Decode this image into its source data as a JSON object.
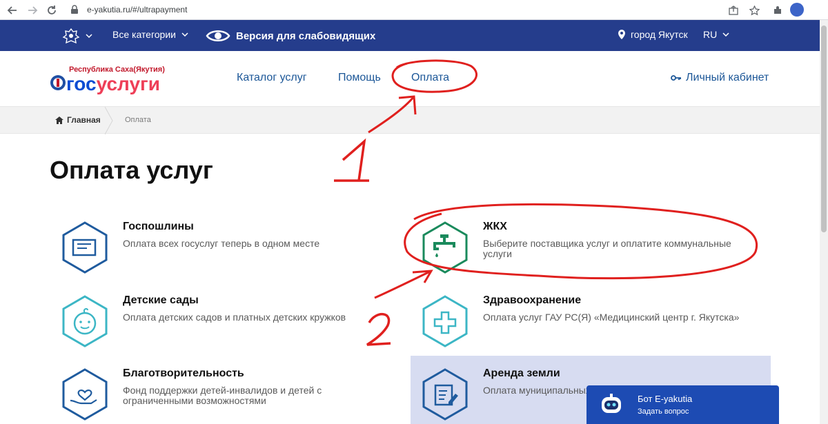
{
  "browser": {
    "url": "e-yakutia.ru/#/ultrapayment",
    "back_icon": "arrow-left-icon",
    "forward_icon": "arrow-right-icon",
    "reload_icon": "reload-icon"
  },
  "topbar": {
    "categories": "Все категории",
    "low_vision": "Версия для слабовидящих",
    "city": "город Якутск",
    "language": "RU"
  },
  "header": {
    "logo_republic": "Республика Саха(Якутия)",
    "logo_gos": "гос",
    "logo_uslugi": "услуги",
    "nav": [
      "Каталог услуг",
      "Помощь",
      "Оплата"
    ],
    "cabinet": "Личный кабинет"
  },
  "breadcrumb": {
    "home": "Главная",
    "current": "Оплата"
  },
  "page_title": "Оплата услуг",
  "services": [
    {
      "title": "Госпошлины",
      "desc": "Оплата всех госуслуг теперь в одном месте",
      "icon": "document-icon",
      "color": "#1f5b9e"
    },
    {
      "title": "ЖКХ",
      "desc": "Выберите поставщика услуг и оплатите коммунальные услуги",
      "icon": "water-tap-icon",
      "color": "#1a8a5c"
    },
    {
      "title": "Детские сады",
      "desc": "Оплата детских садов и платных детских кружков",
      "icon": "baby-face-icon",
      "color": "#3cb6c5"
    },
    {
      "title": "Здравоохранение",
      "desc": "Оплата услуг ГАУ РС(Я) «Медицинский центр г. Якутска»",
      "icon": "medical-cross-icon",
      "color": "#3cb6c5"
    },
    {
      "title": "Благотворительность",
      "desc": "Фонд поддержки детей-инвалидов и детей с ограниченными возможностями",
      "icon": "heart-hand-icon",
      "color": "#1f5b9e"
    },
    {
      "title": "Аренда земли",
      "desc": "Оплата муниципальных",
      "icon": "edit-document-icon",
      "color": "#1f5b9e"
    }
  ],
  "chat": {
    "title": "Бот E-yakutia",
    "subtitle": "Задать вопрос"
  },
  "annotations": [
    "1",
    "2"
  ]
}
